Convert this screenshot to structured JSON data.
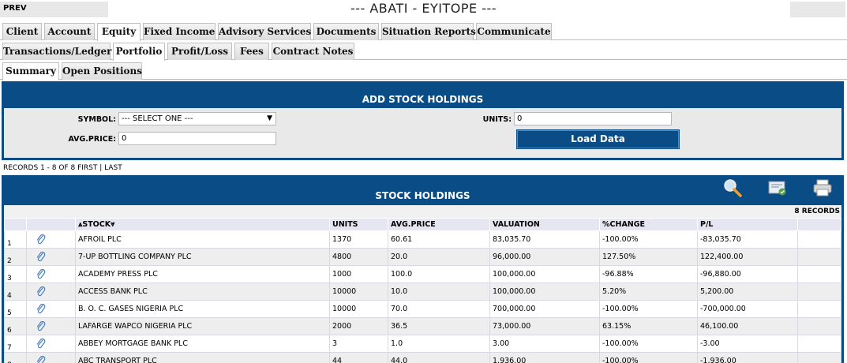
{
  "header": {
    "prev_label": "PREV",
    "title": "--- ABATI - EYITOPE ---"
  },
  "tabs_main": [
    "Client",
    "Account",
    "Equity",
    "Fixed Income",
    "Advisory Services",
    "Documents",
    "Situation Reports",
    "Communicate"
  ],
  "tabs_sub": [
    "Transactions/Ledger",
    "Portfolio",
    "Profit/Loss",
    "Fees",
    "Contract Notes"
  ],
  "tabs_portfolio": [
    "Summary",
    "Open Positions"
  ],
  "add_panel": {
    "title": "ADD STOCK HOLDINGS",
    "symbol_label": "SYMBOL:",
    "symbol_value": "--- SELECT ONE ---",
    "units_label": "UNITS:",
    "units_value": "0",
    "avg_price_label": "AVG.PRICE:",
    "avg_price_value": "0",
    "load_button": "Load Data"
  },
  "pager": {
    "records_text": "RECORDS 1 - 8 OF 8",
    "first": "FIRST",
    "sep": "|",
    "last": "LAST"
  },
  "holdings": {
    "title": "STOCK HOLDINGS",
    "records_count": "8 RECORDS",
    "columns": [
      "STOCK",
      "UNITS",
      "AVG.PRICE",
      "VALUATION",
      "%CHANGE",
      "P/L"
    ],
    "rows": [
      [
        "1",
        "AFROIL PLC",
        "1370",
        "60.61",
        "83,035.70",
        "-100.00%",
        "-83,035.70"
      ],
      [
        "2",
        "7-UP BOTTLING COMPANY PLC",
        "4800",
        "20.0",
        "96,000.00",
        "127.50%",
        "122,400.00"
      ],
      [
        "3",
        "ACADEMY PRESS PLC",
        "1000",
        "100.0",
        "100,000.00",
        "-96.88%",
        "-96,880.00"
      ],
      [
        "4",
        "ACCESS BANK PLC",
        "10000",
        "10.0",
        "100,000.00",
        "5.20%",
        "5,200.00"
      ],
      [
        "5",
        "B. O. C. GASES NIGERIA PLC",
        "10000",
        "70.0",
        "700,000.00",
        "-100.00%",
        "-700,000.00"
      ],
      [
        "6",
        "LAFARGE WAPCO NIGERIA PLC",
        "2000",
        "36.5",
        "73,000.00",
        "63.15%",
        "46,100.00"
      ],
      [
        "7",
        "ABBEY MORTGAGE BANK PLC",
        "3",
        "1.0",
        "3.00",
        "-100.00%",
        "-3.00"
      ],
      [
        "8",
        "ABC TRANSPORT PLC",
        "44",
        "44.0",
        "1,936.00",
        "-100.00%",
        "-1,936.00"
      ]
    ]
  },
  "icons": {
    "row": "paperclip-icon",
    "tools": [
      "search-icon",
      "export-icon",
      "print-icon"
    ]
  },
  "colors": {
    "panel_blue": "#0a4d86"
  }
}
